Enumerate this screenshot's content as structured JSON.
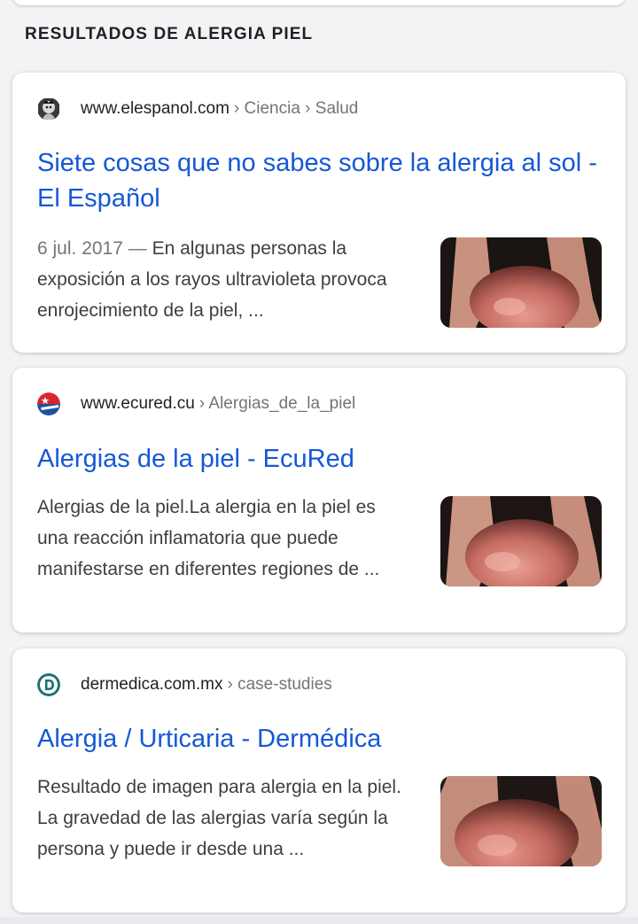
{
  "section": {
    "heading": "RESULTADOS DE ALERGIA PIEL"
  },
  "results": [
    {
      "favicon": "elespanol-logo-icon",
      "domain": "www.elespanol.com",
      "breadcrumb": "› Ciencia › Salud",
      "title": "Siete cosas que no sabes sobre la alergia al sol - El Español",
      "date": "6 jul. 2017 —",
      "snippet": "En algunas personas la exposición a los rayos ultravioleta provoca enrojecimiento de la piel, ...",
      "thumbnail": "skin-allergy-arm-image"
    },
    {
      "favicon": "ecured-logo-icon",
      "domain": "www.ecured.cu",
      "breadcrumb": "› Alergias_de_la_piel",
      "title": "Alergias de la piel - EcuRed",
      "date": "",
      "snippet": "Alergias de la piel.La alergia en la piel es una reacción inflamatoria que puede manifestarse en diferentes regiones de ...",
      "thumbnail": "skin-allergy-arm-image"
    },
    {
      "favicon": "dermedica-logo-icon",
      "domain": "dermedica.com.mx",
      "breadcrumb": "› case-studies",
      "title": "Alergia / Urticaria - Dermédica",
      "date": "",
      "snippet": "Resultado de imagen para alergia en la piel. La gravedad de las alergias varía según la persona y puede ir desde una ...",
      "thumbnail": "skin-allergy-arm-image"
    }
  ],
  "colors": {
    "link": "#1558d6",
    "text": "#3c4043",
    "muted": "#70757a",
    "background": "#f1f3f4"
  }
}
